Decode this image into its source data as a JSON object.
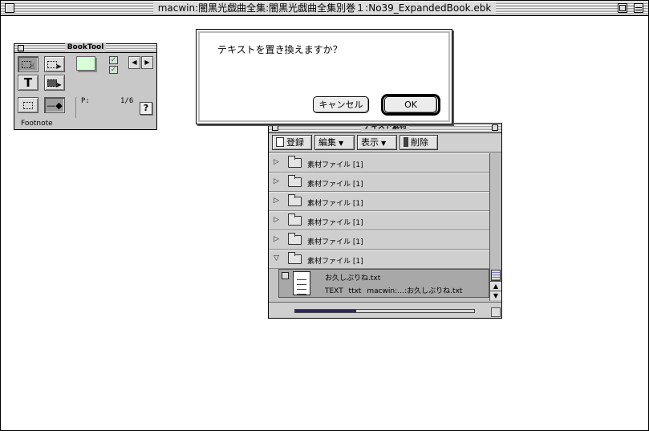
{
  "window": {
    "title": "macwin:闇黒光戯曲全集:闇黒光戯曲全集別巻１:No39_ExpandedBook.ebk"
  },
  "booktool": {
    "title": "BookTool",
    "text_tool": "T",
    "page_label": "P:",
    "page_value": "1/6",
    "help": "?",
    "footnote": "Footnote",
    "swatch_color": "#d6ffd8",
    "checks": [
      "✓",
      "✓"
    ],
    "arrows": [
      "◀",
      "▶"
    ]
  },
  "material": {
    "title": "テキスト素材",
    "toolbar": {
      "register": "登録",
      "edit": "編集",
      "view": "表示",
      "delete": "削除"
    },
    "folders": [
      {
        "label": "素材ファイル [1]",
        "expanded": false
      },
      {
        "label": "素材ファイル [1]",
        "expanded": false
      },
      {
        "label": "素材ファイル [1]",
        "expanded": false
      },
      {
        "label": "素材ファイル [1]",
        "expanded": false
      },
      {
        "label": "素材ファイル [1]",
        "expanded": false
      },
      {
        "label": "素材ファイル [1]",
        "expanded": true
      }
    ],
    "file": {
      "name": "お久しぶりね.txt",
      "meta": "TEXT ttxt macwin:…:お久しぶりね.txt"
    },
    "hscroll_fraction": 0.34
  },
  "dialog": {
    "message": "テキストを置き換えますか？",
    "cancel": "キャンセル",
    "ok": "OK"
  }
}
